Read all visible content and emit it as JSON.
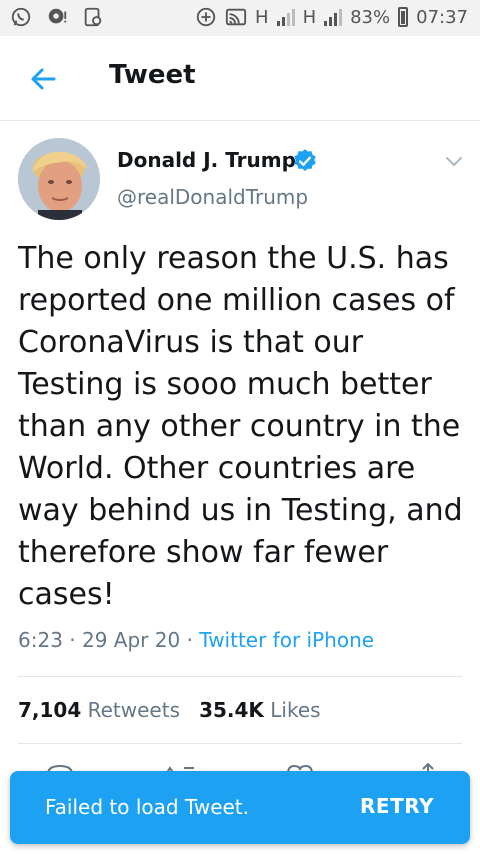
{
  "status_bar": {
    "battery": "83%",
    "time": "07:37",
    "network1": "H",
    "network2": "H",
    "icons": [
      "whatsapp-icon",
      "chat-icon",
      "clipboard-icon",
      "data-saver-icon",
      "cast-icon",
      "signal-icon",
      "battery-icon"
    ]
  },
  "header": {
    "title": "Tweet",
    "back_icon": "arrow-left-icon"
  },
  "tweet": {
    "author_name": "Donald J. Trump",
    "handle": "@realDonaldTrump",
    "text": "The only reason the U.S. has reported one million cases of CoronaVirus is that our Testing is sooo much better than any other country in the World. Other countries are way behind us in Testing, and therefore show far fewer cases!",
    "time": "6:23",
    "sep1": "·",
    "date": "29 Apr 20",
    "sep2": "·",
    "source": "Twitter for iPhone",
    "retweets_count": "7,104",
    "retweets_label": "Retweets",
    "likes_count": "35.4K",
    "likes_label": "Likes"
  },
  "snackbar": {
    "message": "Failed to load Tweet.",
    "action": "RETRY"
  },
  "colors": {
    "accent": "#1da1f2",
    "text": "#14171a",
    "secondary": "#657786",
    "divider": "#e1e8ed"
  }
}
